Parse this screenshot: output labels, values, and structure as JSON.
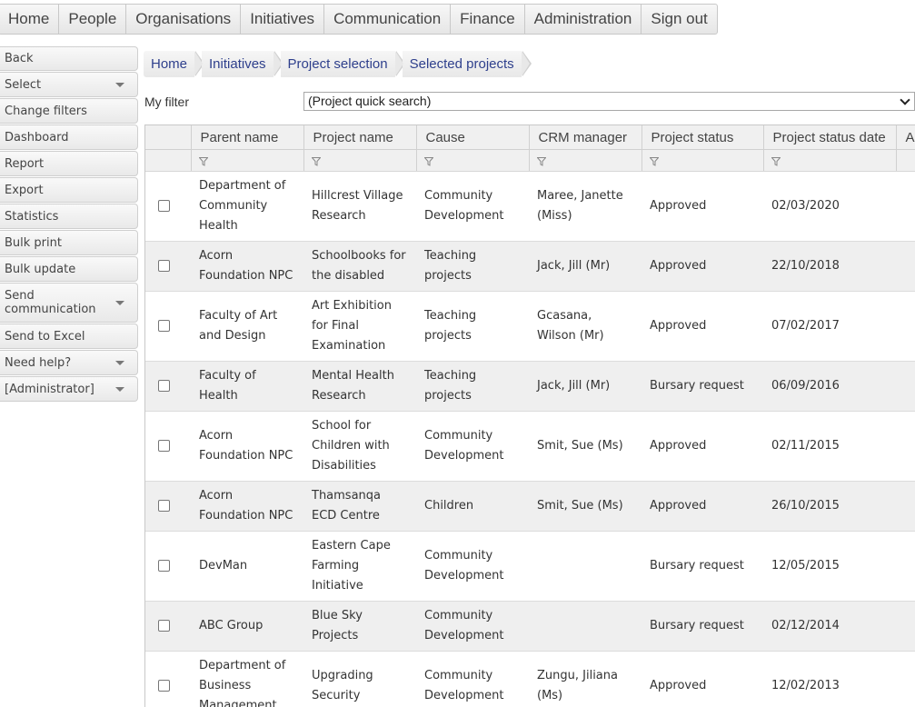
{
  "topnav": {
    "items": [
      "Home",
      "People",
      "Organisations",
      "Initiatives",
      "Communication",
      "Finance",
      "Administration",
      "Sign out"
    ]
  },
  "sidebar": {
    "items": [
      {
        "label": "Back",
        "dropdown": false
      },
      {
        "label": "Select",
        "dropdown": true
      },
      {
        "label": "Change filters",
        "dropdown": false
      },
      {
        "label": "Dashboard",
        "dropdown": false
      },
      {
        "label": "Report",
        "dropdown": false
      },
      {
        "label": "Export",
        "dropdown": false
      },
      {
        "label": "Statistics",
        "dropdown": false
      },
      {
        "label": "Bulk print",
        "dropdown": false
      },
      {
        "label": "Bulk update",
        "dropdown": false
      },
      {
        "label": "Send communication",
        "dropdown": true
      },
      {
        "label": "Send to Excel",
        "dropdown": false
      },
      {
        "label": "Need help?",
        "dropdown": true
      },
      {
        "label": "[Administrator]",
        "dropdown": true
      }
    ]
  },
  "breadcrumb": [
    "Home",
    "Initiatives",
    "Project selection",
    "Selected projects"
  ],
  "filter": {
    "label": "My filter",
    "selected": "(Project quick search)"
  },
  "table": {
    "columns": [
      "Parent name",
      "Project name",
      "Cause",
      "CRM manager",
      "Project status",
      "Project status date",
      "A"
    ],
    "rows": [
      [
        "Department of Community Health",
        "Hillcrest Village Research",
        "Community Development",
        "Maree, Janette (Miss)",
        "Approved",
        "02/03/2020"
      ],
      [
        "Acorn Foundation NPC",
        "Schoolbooks for the disabled",
        "Teaching projects",
        "Jack, Jill (Mr)",
        "Approved",
        "22/10/2018"
      ],
      [
        "Faculty of Art and Design",
        "Art Exhibition for Final Examination",
        "Teaching projects",
        "Gcasana, Wilson (Mr)",
        "Approved",
        "07/02/2017"
      ],
      [
        "Faculty of Health",
        "Mental Health Research",
        "Teaching projects",
        "Jack, Jill (Mr)",
        "Bursary request",
        "06/09/2016"
      ],
      [
        "Acorn Foundation NPC",
        "School for Children with Disabilities",
        "Community Development",
        "Smit, Sue (Ms)",
        "Approved",
        "02/11/2015"
      ],
      [
        "Acorn Foundation NPC",
        "Thamsanqa ECD Centre",
        "Children",
        "Smit, Sue (Ms)",
        "Approved",
        "26/10/2015"
      ],
      [
        "DevMan",
        "Eastern Cape Farming Initiative",
        "Community Development",
        "",
        "Bursary request",
        "12/05/2015"
      ],
      [
        "ABC Group",
        "Blue Sky Projects",
        "Community Development",
        "",
        "Bursary request",
        "02/12/2014"
      ],
      [
        "Department of Business Management",
        "Upgrading Security",
        "Community Development",
        "Zungu, Jiliana (Ms)",
        "Approved",
        "12/02/2013"
      ]
    ]
  }
}
